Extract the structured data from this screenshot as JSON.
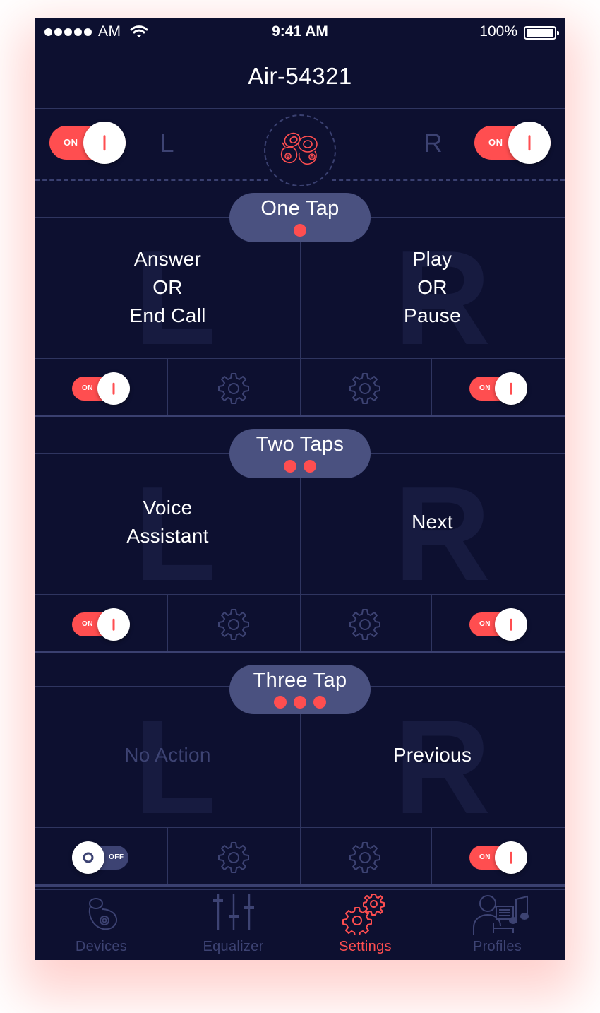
{
  "status_bar": {
    "carrier": "AM",
    "time": "9:41 AM",
    "battery": "100%"
  },
  "header": {
    "title": "Air-54321"
  },
  "device": {
    "left_label": "L",
    "right_label": "R",
    "left_toggle": "ON",
    "right_toggle": "ON"
  },
  "sections": [
    {
      "title": "One Tap",
      "taps": 1,
      "left_letter": "L",
      "right_letter": "R",
      "left_action": [
        "Answer",
        "OR",
        "End Call"
      ],
      "right_action": [
        "Play",
        "OR",
        "Pause"
      ],
      "left_toggle": "ON",
      "right_toggle": "ON"
    },
    {
      "title": "Two Taps",
      "taps": 2,
      "left_letter": "L",
      "right_letter": "R",
      "left_action": [
        "Voice",
        "Assistant"
      ],
      "right_action": [
        "Next"
      ],
      "left_toggle": "ON",
      "right_toggle": "ON"
    },
    {
      "title": "Three Tap",
      "taps": 3,
      "left_letter": "L",
      "right_letter": "R",
      "left_action": [
        "No Action"
      ],
      "right_action": [
        "Previous"
      ],
      "left_toggle": "OFF",
      "right_toggle": "ON"
    }
  ],
  "tabs": [
    {
      "label": "Devices",
      "icon": "earbud-icon",
      "active": false
    },
    {
      "label": "Equalizer",
      "icon": "equalizer-icon",
      "active": false
    },
    {
      "label": "Settings",
      "icon": "settings-gears-icon",
      "active": true
    },
    {
      "label": "Profiles",
      "icon": "profiles-icon",
      "active": false
    }
  ],
  "colors": {
    "background": "#0d1030",
    "accent": "#ff4e50",
    "muted": "#3d4373",
    "pill": "#4a5180"
  }
}
